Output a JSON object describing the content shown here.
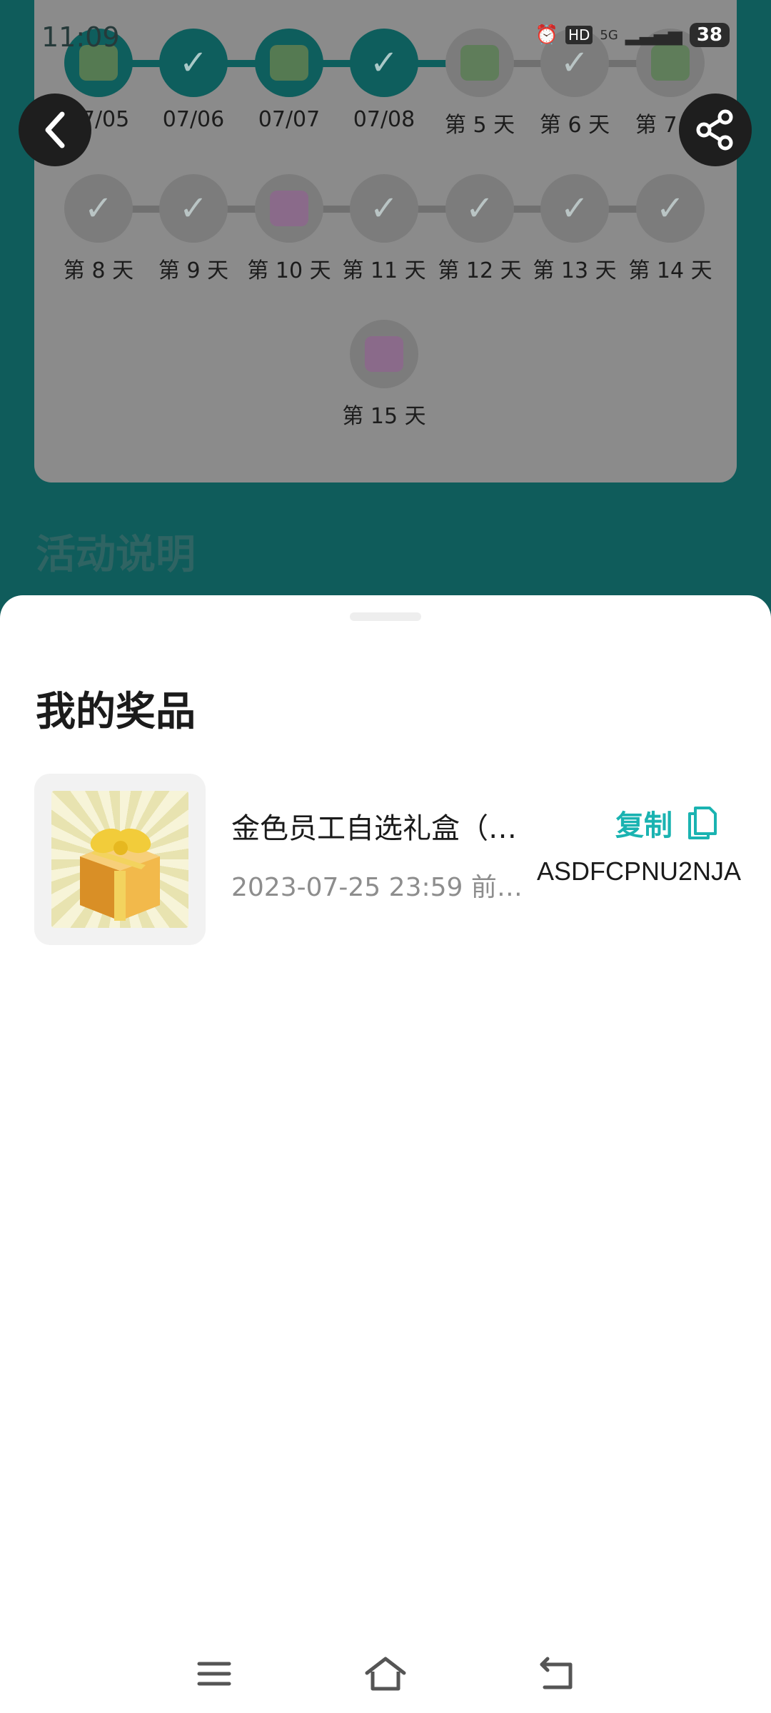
{
  "status_bar": {
    "time": "11:09",
    "hd": "HD",
    "network": "5G",
    "battery": "38"
  },
  "checkin": {
    "days": [
      {
        "label": "07/05",
        "state": "done",
        "icon": "prize-icon"
      },
      {
        "label": "07/06",
        "state": "done",
        "icon": "check-icon"
      },
      {
        "label": "07/07",
        "state": "done",
        "icon": "prize-icon"
      },
      {
        "label": "07/08",
        "state": "done",
        "icon": "check-icon"
      },
      {
        "label": "第 5 天",
        "state": "todo",
        "icon": "prize-icon"
      },
      {
        "label": "第 6 天",
        "state": "todo",
        "icon": "check-icon"
      },
      {
        "label": "第 7 天",
        "state": "todo",
        "icon": "prize-icon"
      },
      {
        "label": "第 8 天",
        "state": "todo",
        "icon": "check-icon"
      },
      {
        "label": "第 9 天",
        "state": "todo",
        "icon": "check-icon"
      },
      {
        "label": "第 10 天",
        "state": "todo",
        "icon": "gift-icon"
      },
      {
        "label": "第 11 天",
        "state": "todo",
        "icon": "check-icon"
      },
      {
        "label": "第 12 天",
        "state": "todo",
        "icon": "check-icon"
      },
      {
        "label": "第 13 天",
        "state": "todo",
        "icon": "check-icon"
      },
      {
        "label": "第 14 天",
        "state": "todo",
        "icon": "check-icon"
      },
      {
        "label": "第 15 天",
        "state": "todo",
        "icon": "gift-icon"
      }
    ]
  },
  "activity": {
    "title": "活动说明"
  },
  "sheet": {
    "title": "我的奖品",
    "prizes": [
      {
        "name": "金色员工自选礼盒（…",
        "date": "2023-07-25 23:59 前…",
        "copy_label": "复制",
        "code": "ASDFCPNU2NJA"
      }
    ]
  },
  "colors": {
    "accent": "#1ab3b1",
    "done": "#0e5e5d",
    "page_bg": "#0f5c5b"
  },
  "nav": {
    "menu_icon": "menu-icon",
    "home_icon": "home-icon",
    "back_icon": "return-icon"
  }
}
